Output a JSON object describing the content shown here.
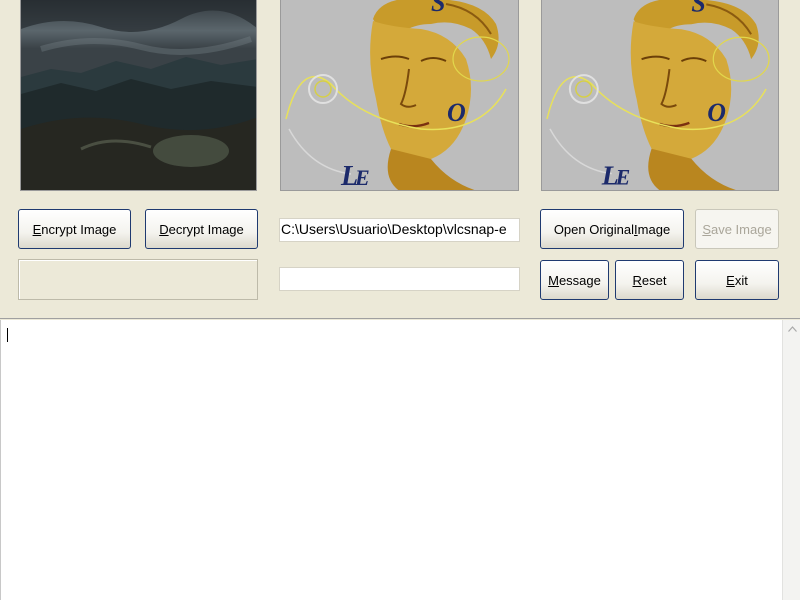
{
  "buttons": {
    "encrypt": {
      "label_pre": "",
      "label_key": "E",
      "label_post": "ncrypt Image"
    },
    "decrypt": {
      "label_pre": "",
      "label_key": "D",
      "label_post": "ecrypt Image"
    },
    "open_original": {
      "label_pre": "Open Original ",
      "label_key": "I",
      "label_post": "mage"
    },
    "save": {
      "label_pre": "",
      "label_key": "S",
      "label_post": "ave Image"
    },
    "message": {
      "label_pre": "",
      "label_key": "M",
      "label_post": "essage"
    },
    "reset": {
      "label_pre": "",
      "label_key": "R",
      "label_post": "eset"
    },
    "exit": {
      "label_pre": "",
      "label_key": "E",
      "label_post": "xit"
    }
  },
  "fields": {
    "file_path": "C:\\Users\\Usuario\\Desktop\\vlcsnap-e",
    "status_left": "",
    "status_center": ""
  },
  "message_text": "",
  "images": {
    "carrier": "mountain-landscape-image",
    "secret": "sculpture-head-image",
    "output": "sculpture-head-image"
  },
  "sculpture_letters": [
    "S",
    "O",
    "L",
    "E"
  ]
}
